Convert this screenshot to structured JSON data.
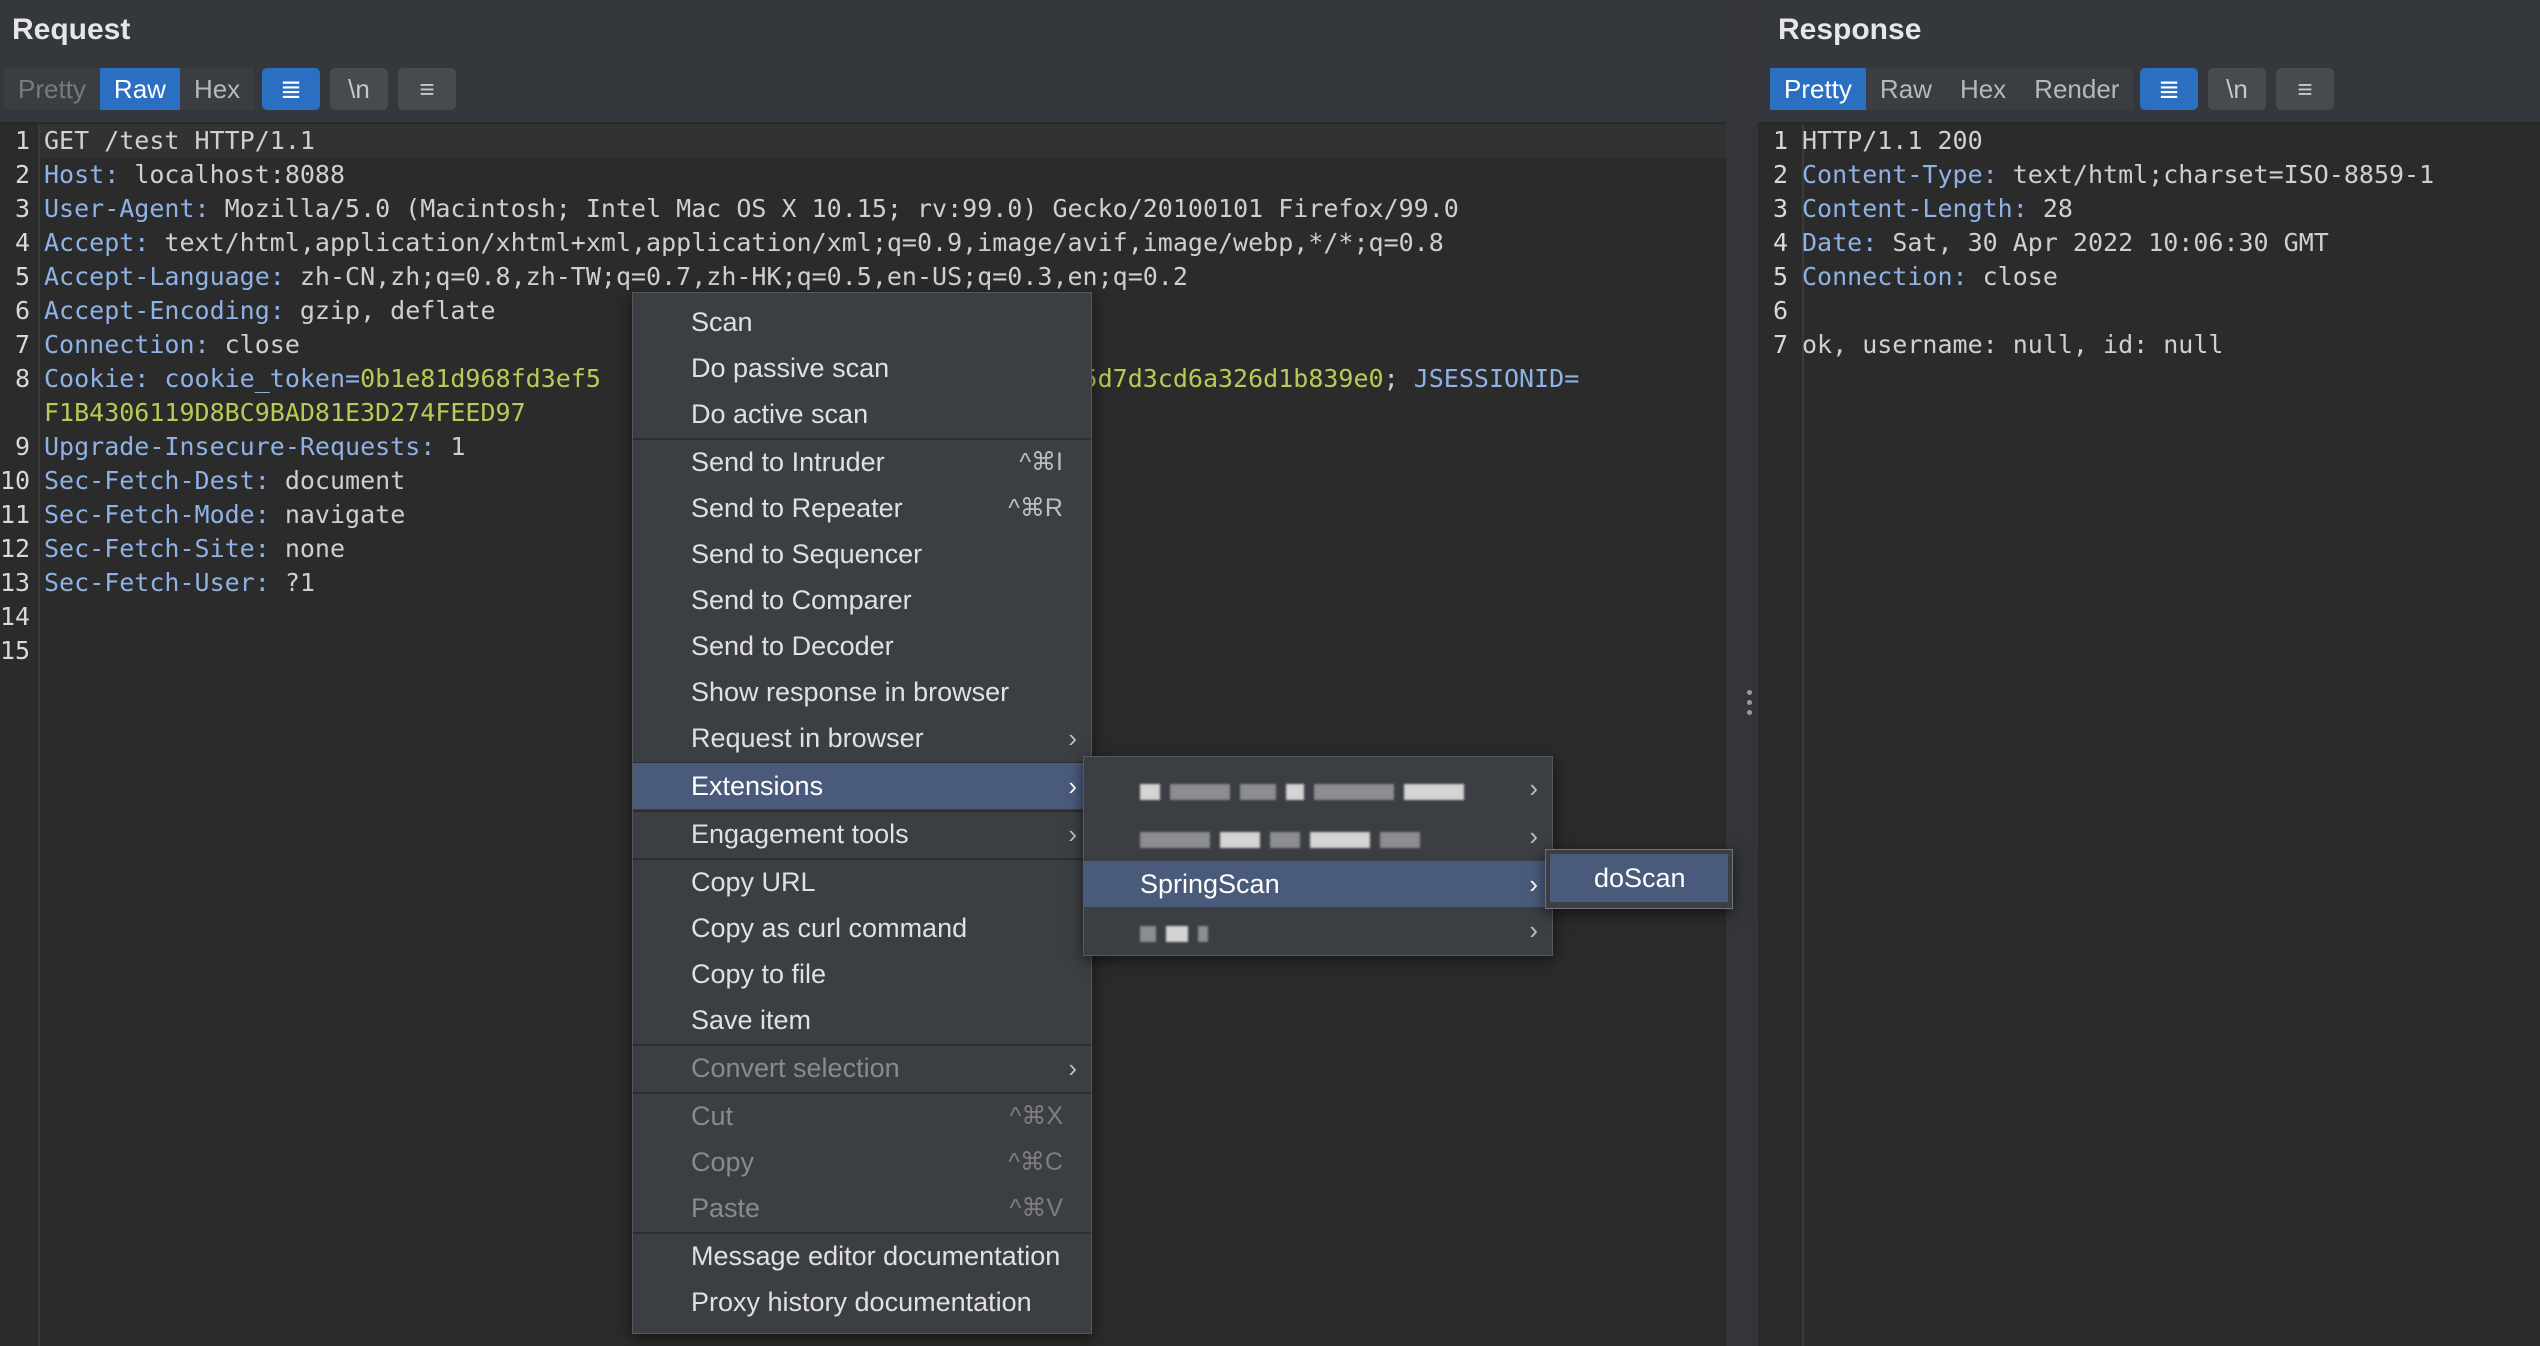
{
  "request": {
    "title": "Request",
    "tabs": [
      "Pretty",
      "Raw",
      "Hex"
    ],
    "active_tab": "Raw",
    "tools": {
      "wrap": "≣",
      "newline": "\\n",
      "menu": "≡"
    },
    "lines": [
      {
        "n": "1",
        "text": "GET /test HTTP/1.1"
      },
      {
        "n": "2",
        "key": "Host:",
        "val": " localhost:8088"
      },
      {
        "n": "3",
        "key": "User-Agent:",
        "val": " Mozilla/5.0 (Macintosh; Intel Mac OS X 10.15; rv:99.0) Gecko/20100101 Firefox/99.0"
      },
      {
        "n": "4",
        "key": "Accept:",
        "val": " text/html,application/xhtml+xml,application/xml;q=0.9,image/avif,image/webp,*/*;q=0.8"
      },
      {
        "n": "5",
        "key": "Accept-Language:",
        "val": " zh-CN,zh;q=0.8,zh-TW;q=0.7,zh-HK;q=0.5,en-US;q=0.3,en;q=0.2"
      },
      {
        "n": "6",
        "key": "Accept-Encoding:",
        "val": " gzip, deflate"
      },
      {
        "n": "7",
        "key": "Connection:",
        "val": " close"
      },
      {
        "n": "8",
        "key": "Cookie:",
        "c1k": " cookie_token=",
        "c1v": "0b1e81d968fd3ef5",
        "c1v2": "                                5d7d3cd6a326d1b839e0",
        "sep": "; ",
        "c2k": "JSESSIONID=",
        "c2v": "F1B4306119D8BC9BAD81E3D274FEED97"
      },
      {
        "n": "9",
        "key": "Upgrade-Insecure-Requests:",
        "val": " 1"
      },
      {
        "n": "10",
        "key": "Sec-Fetch-Dest:",
        "val": " document"
      },
      {
        "n": "11",
        "key": "Sec-Fetch-Mode:",
        "val": " navigate"
      },
      {
        "n": "12",
        "key": "Sec-Fetch-Site:",
        "val": " none"
      },
      {
        "n": "13",
        "key": "Sec-Fetch-User:",
        "val": " ?1"
      },
      {
        "n": "14",
        "text": ""
      },
      {
        "n": "15",
        "text": ""
      }
    ]
  },
  "response": {
    "title": "Response",
    "tabs": [
      "Pretty",
      "Raw",
      "Hex",
      "Render"
    ],
    "active_tab": "Pretty",
    "tools": {
      "wrap": "≣",
      "newline": "\\n",
      "menu": "≡"
    },
    "lines": [
      {
        "n": "1",
        "text": "HTTP/1.1 200"
      },
      {
        "n": "2",
        "key": "Content-Type:",
        "val": " text/html;charset=ISO-8859-1"
      },
      {
        "n": "3",
        "key": "Content-Length:",
        "val": " 28"
      },
      {
        "n": "4",
        "key": "Date:",
        "val": " Sat, 30 Apr 2022 10:06:30 GMT"
      },
      {
        "n": "5",
        "key": "Connection:",
        "val": " close"
      },
      {
        "n": "6",
        "text": ""
      },
      {
        "n": "7",
        "text": "ok, username: null, id: null"
      }
    ]
  },
  "context_menu": {
    "items": [
      {
        "label": "Scan"
      },
      {
        "label": "Do passive scan"
      },
      {
        "label": "Do active scan"
      },
      {
        "sep": true
      },
      {
        "label": "Send to Intruder",
        "shortcut": "^⌘I"
      },
      {
        "label": "Send to Repeater",
        "shortcut": "^⌘R"
      },
      {
        "label": "Send to Sequencer"
      },
      {
        "label": "Send to Comparer"
      },
      {
        "label": "Send to Decoder"
      },
      {
        "label": "Show response in browser"
      },
      {
        "label": "Request in browser",
        "submenu": true
      },
      {
        "sep": true
      },
      {
        "label": "Extensions",
        "submenu": true,
        "highlighted": true
      },
      {
        "sep": true
      },
      {
        "label": "Engagement tools",
        "submenu": true
      },
      {
        "sep": true
      },
      {
        "label": "Copy URL"
      },
      {
        "label": "Copy as curl command"
      },
      {
        "label": "Copy to file"
      },
      {
        "label": "Save item"
      },
      {
        "sep": true
      },
      {
        "label": "Convert selection",
        "submenu": true,
        "disabled": true
      },
      {
        "sep": true
      },
      {
        "label": "Cut",
        "shortcut": "^⌘X",
        "disabled": true
      },
      {
        "label": "Copy",
        "shortcut": "^⌘C",
        "disabled": true
      },
      {
        "label": "Paste",
        "shortcut": "^⌘V",
        "disabled": true
      },
      {
        "sep": true
      },
      {
        "label": "Message editor documentation"
      },
      {
        "label": "Proxy history documentation"
      }
    ]
  },
  "extensions_menu": {
    "selected_label": "SpringScan",
    "arrow": "›"
  },
  "springscan_menu": {
    "item_label": "doScan"
  }
}
